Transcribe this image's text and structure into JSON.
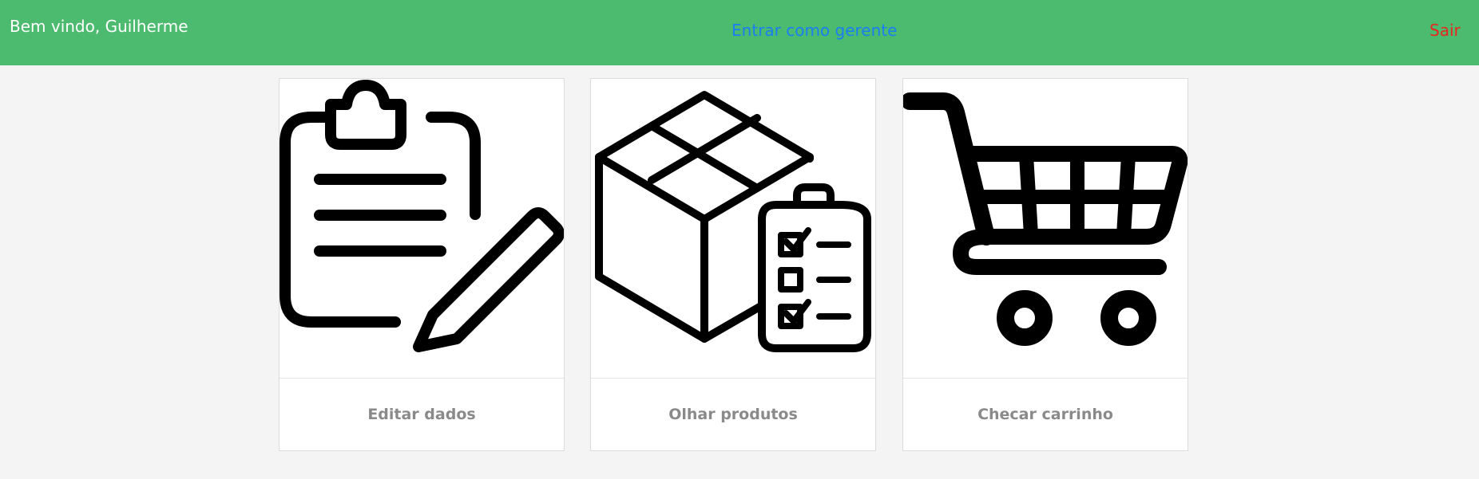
{
  "header": {
    "welcome_text": "Bem vindo, Guilherme",
    "manager_link": "Entrar como gerente",
    "logout_link": "Sair"
  },
  "cards": [
    {
      "label": "Editar dados",
      "icon": "clipboard-edit-icon"
    },
    {
      "label": "Olhar produtos",
      "icon": "box-checklist-icon"
    },
    {
      "label": "Checar carrinho",
      "icon": "shopping-cart-icon"
    }
  ],
  "colors": {
    "header_bg": "#4dbb6f",
    "manager_link": "#1a7ef2",
    "logout_link": "#e8261f",
    "card_label": "#8a8a8a",
    "page_bg": "#f4f4f4"
  }
}
